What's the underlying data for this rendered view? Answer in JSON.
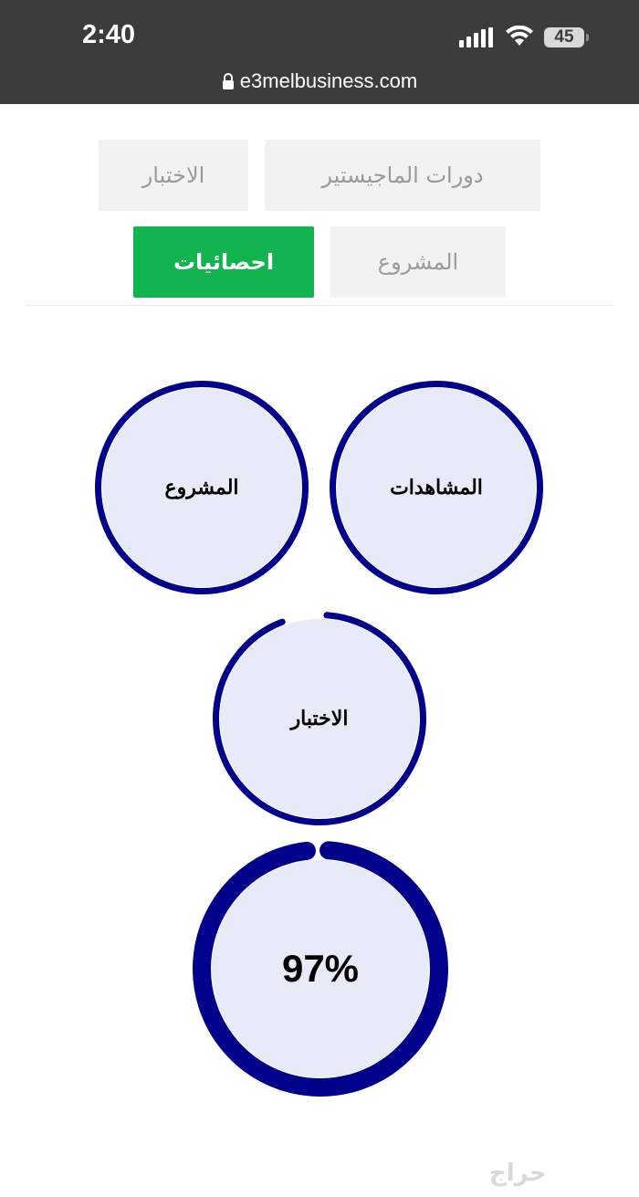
{
  "status_bar": {
    "time": "2:40",
    "battery": "45",
    "icons": [
      "signal-icon",
      "wifi-icon",
      "battery-icon"
    ]
  },
  "browser": {
    "url": "e3melbusiness.com",
    "lock_icon": "lock-icon"
  },
  "tabs": [
    {
      "label": "دورات الماجيستير",
      "active": false
    },
    {
      "label": "الاختبار",
      "active": false
    },
    {
      "label": "المشروع",
      "active": false
    },
    {
      "label": "احصائيات",
      "active": true
    }
  ],
  "stats": [
    {
      "label": "المشاهدات",
      "progress": 1.0
    },
    {
      "label": "المشروع",
      "progress": 1.0
    },
    {
      "label": "الاختبار",
      "progress": 0.93
    },
    {
      "label": "97%",
      "progress": 0.97
    }
  ],
  "colors": {
    "accent_green": "#12b450",
    "ring_navy": "#00008b",
    "circle_fill": "#e6ebf7",
    "top_bar": "#3a3d3c"
  },
  "watermark": "حراج"
}
